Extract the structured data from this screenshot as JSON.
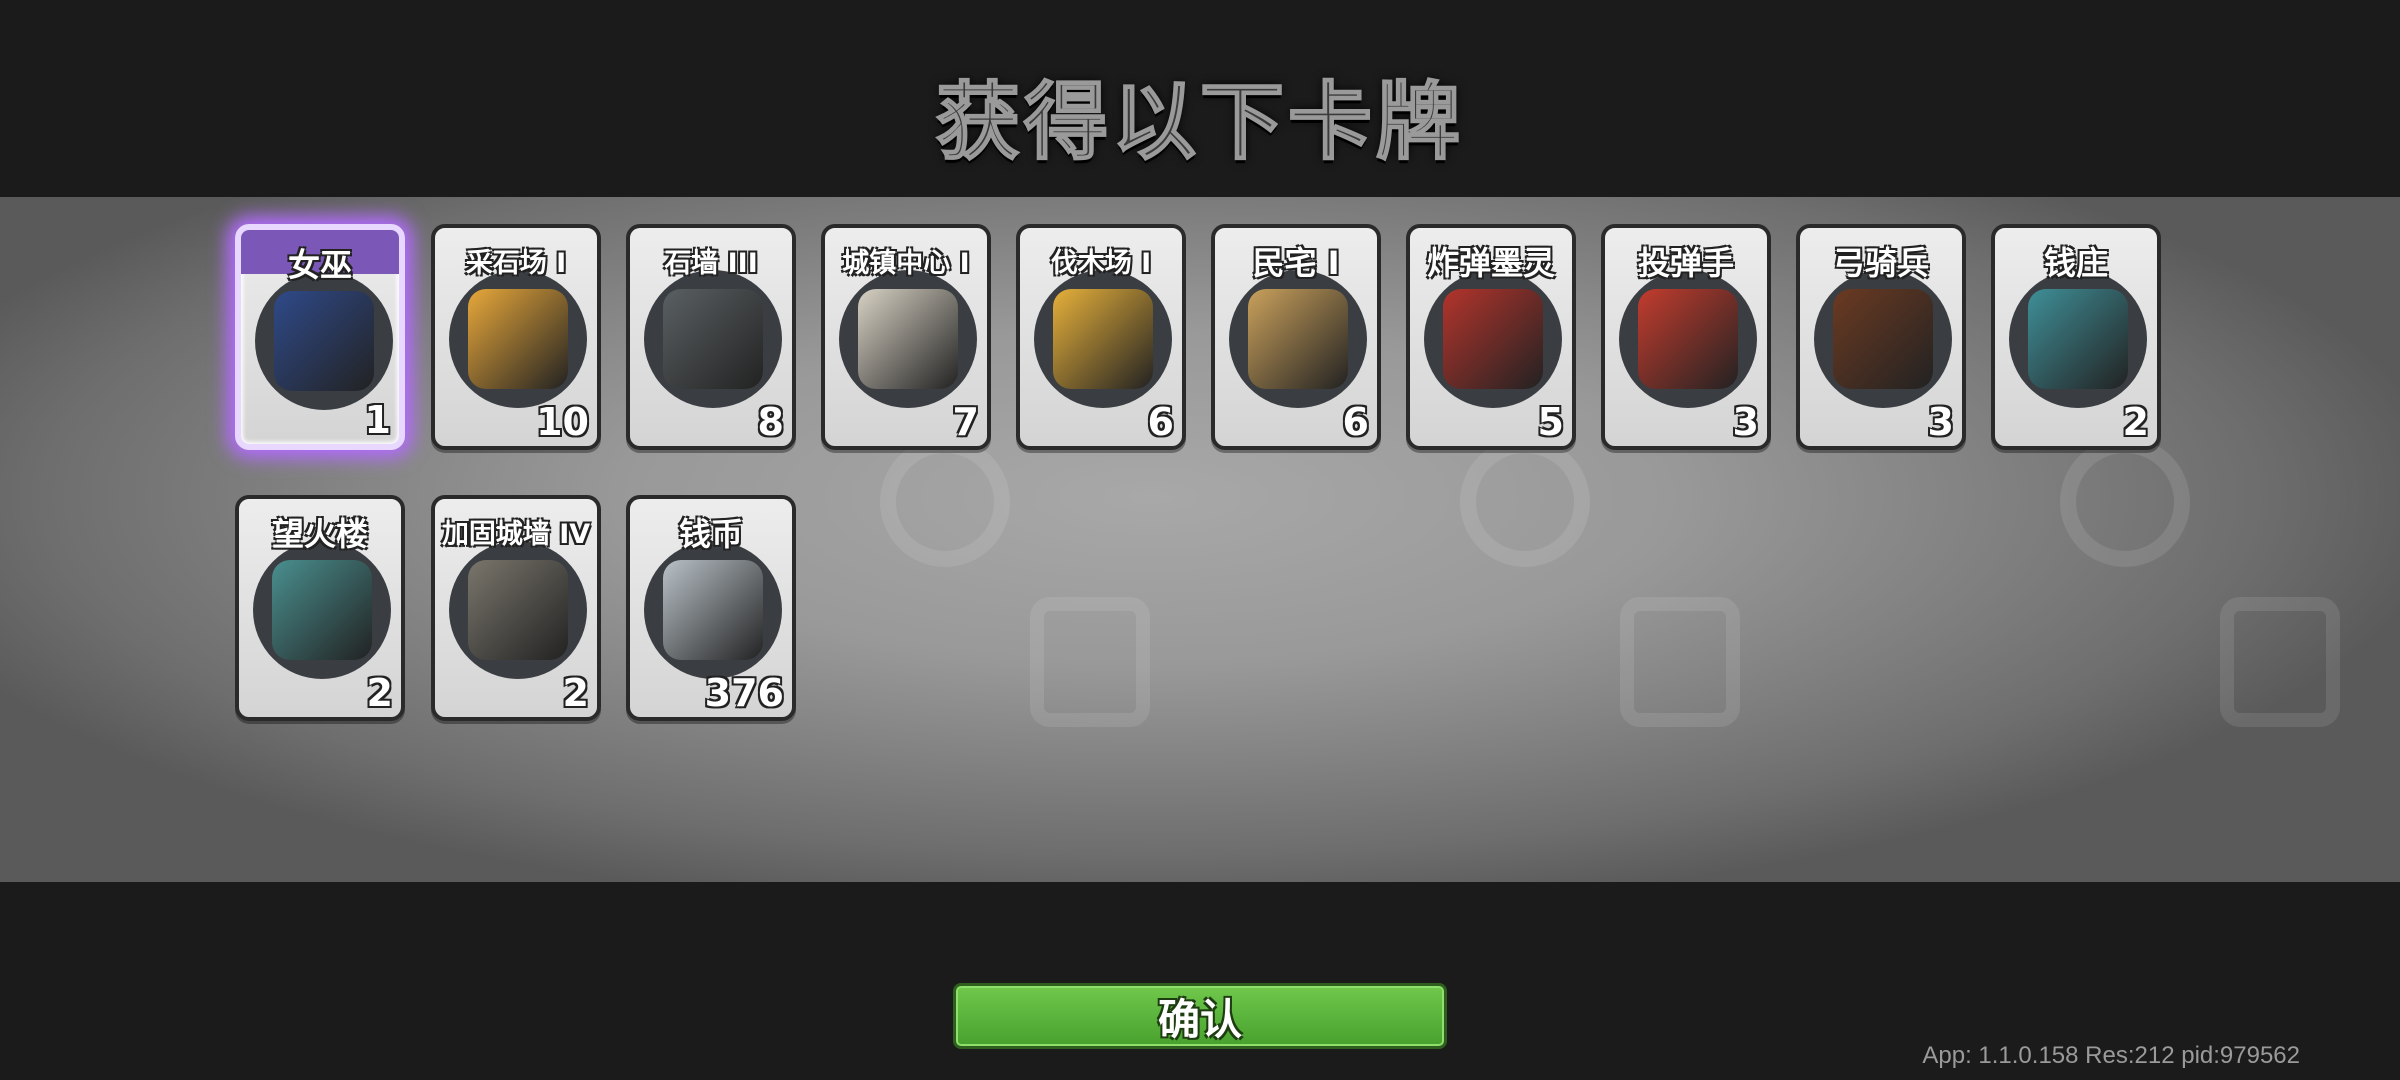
{
  "title": "获得以下卡牌",
  "cards": [
    {
      "name": "女巫",
      "count": "1",
      "icon": "witch-icon",
      "color": "#2f4a8a",
      "selected": true
    },
    {
      "name": "采石场 I",
      "count": "10",
      "icon": "quarry-icon",
      "color": "#e8a83a"
    },
    {
      "name": "石墙 III",
      "count": "8",
      "icon": "stone-wall-icon",
      "color": "#5a6062"
    },
    {
      "name": "城镇中心 I",
      "count": "7",
      "icon": "town-center-icon",
      "color": "#d8d2c4"
    },
    {
      "name": "伐木场 I",
      "count": "6",
      "icon": "lumber-mill-icon",
      "color": "#e7b13b"
    },
    {
      "name": "民宅 I",
      "count": "6",
      "icon": "house-icon",
      "color": "#caa15c"
    },
    {
      "name": "炸弹墨灵",
      "count": "5",
      "icon": "bomb-imp-icon",
      "color": "#b3342c"
    },
    {
      "name": "投弹手",
      "count": "3",
      "icon": "bomber-icon",
      "color": "#c33c2e"
    },
    {
      "name": "弓骑兵",
      "count": "3",
      "icon": "horse-archer-icon",
      "color": "#6b3a22"
    },
    {
      "name": "钱庄",
      "count": "2",
      "icon": "bank-icon",
      "color": "#3f8f98"
    },
    {
      "name": "望火楼",
      "count": "2",
      "icon": "watchtower-icon",
      "color": "#4a8f8f"
    },
    {
      "name": "加固城墙 IV",
      "count": "2",
      "icon": "fortified-wall-icon",
      "color": "#7a766c"
    },
    {
      "name": "钱币",
      "count": "376",
      "icon": "coin-icon",
      "color": "#b9c2c8"
    }
  ],
  "confirm_label": "确认",
  "version": "App: 1.1.0.158 Res:212 pid:979562"
}
